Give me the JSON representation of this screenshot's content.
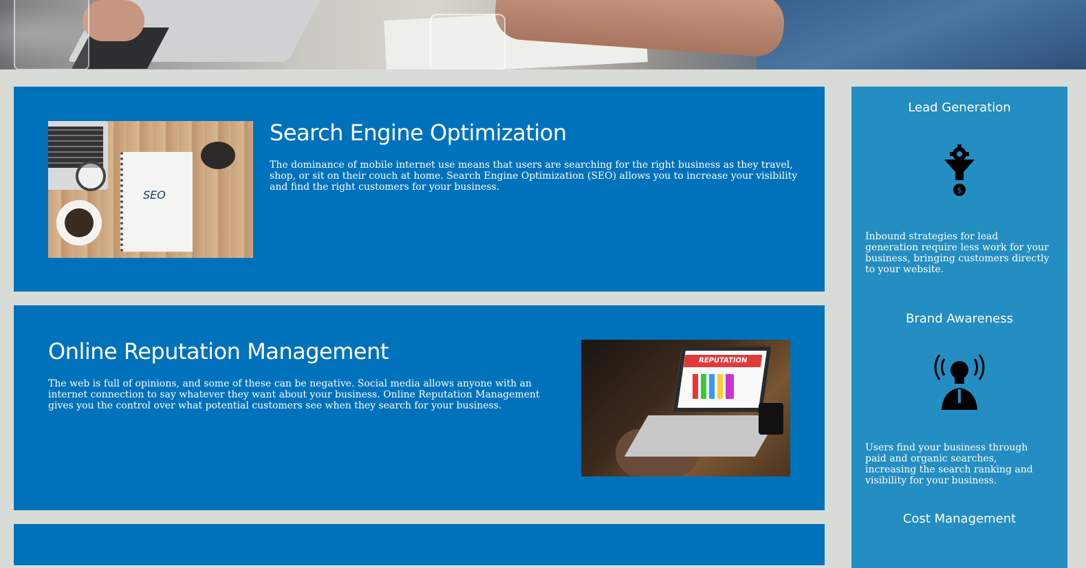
{
  "hero": {
    "alt": "office desk photo"
  },
  "services": [
    {
      "title": "Search Engine Optimization",
      "text": "The dominance of mobile internet use means that users are searching for the right business as they travel, shop, or sit on their couch at home. Search Engine Optimization (SEO) allows you to increase your visibility and find the right customers for your business.",
      "image_text": "SEO"
    },
    {
      "title": "Online Reputation Management",
      "text": "The web is full of opinions, and some of these can be negative. Social media allows anyone with an internet connection to say whatever they want about your business. Online Reputation Management gives you the control over what potential customers see when they search for your business.",
      "image_text": "REPUTATION"
    }
  ],
  "benefits": [
    {
      "title": "Lead Generation",
      "icon": "lead-generation-funnel-icon",
      "text": "Inbound strategies for lead generation require less work for your business, bringing customers directly to your website."
    },
    {
      "title": "Brand Awareness",
      "icon": "brand-awareness-lightbulb-icon",
      "text": "Users find your business through paid and organic searches, increasing the search ranking and visibility for your business."
    },
    {
      "title": "Cost Management",
      "icon": "",
      "text": ""
    }
  ],
  "colors": {
    "page_bg": "#d9dcd6",
    "card_bg": "#0072bc",
    "sidebar_bg": "#248dc1",
    "text": "#ffffff"
  }
}
